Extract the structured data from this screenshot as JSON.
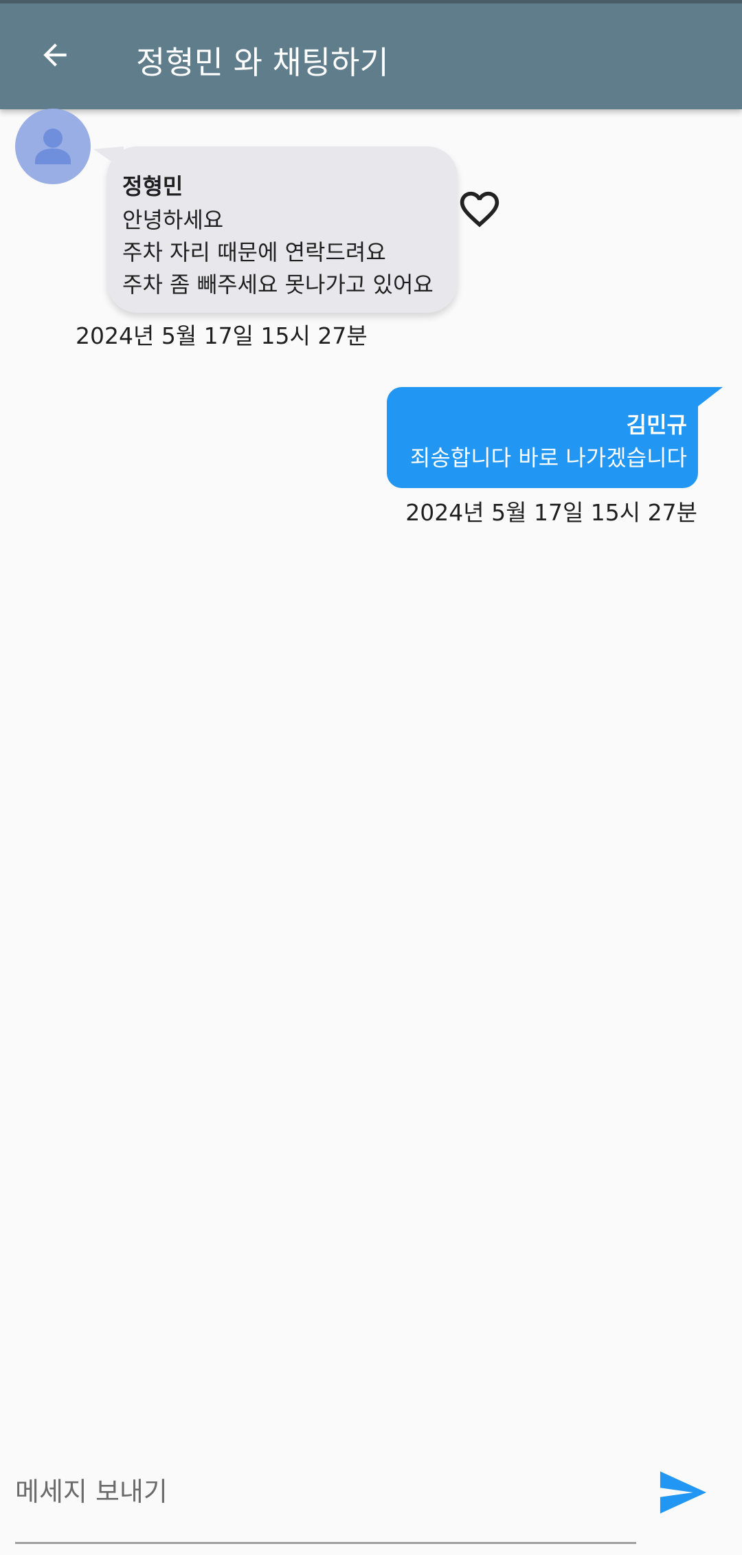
{
  "appbar": {
    "title": "정형민 와 채팅하기",
    "back_icon": "arrow-back-icon",
    "color": "#607d8b"
  },
  "messages": [
    {
      "direction": "incoming",
      "sender": "정형민",
      "lines": [
        "안녕하세요",
        "주차 자리 때문에 연락드려요",
        "주차 좀 빼주세요 못나가고 있어요"
      ],
      "timestamp": "2024년 5월 17일 15시 27분",
      "bubble_color": "#e7e7ec",
      "avatar_icon": "person-icon",
      "reaction_icon": "heart-outline-icon",
      "liked": false
    },
    {
      "direction": "outgoing",
      "sender": "김민규",
      "lines": [
        "죄송합니다 바로 나가겠습니다"
      ],
      "timestamp": "2024년 5월 17일 15시 27분",
      "bubble_color": "#2196f3"
    }
  ],
  "composer": {
    "placeholder": "메세지 보내기",
    "value": "",
    "send_icon": "send-icon",
    "send_color": "#2196f3"
  }
}
